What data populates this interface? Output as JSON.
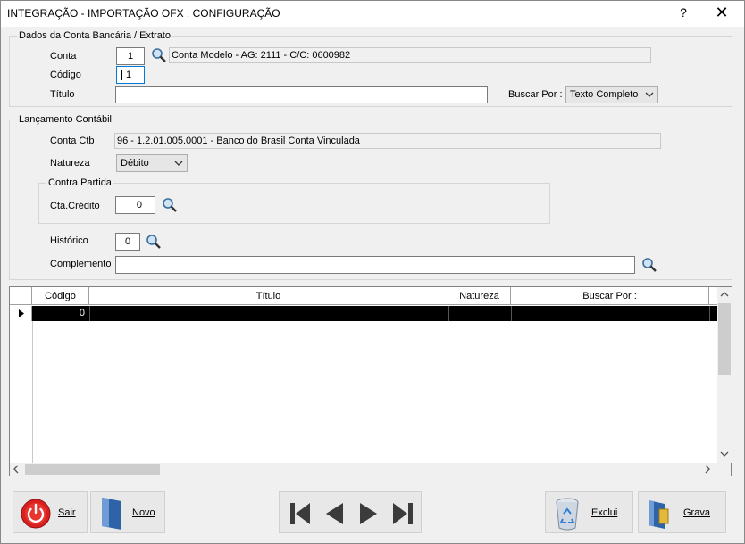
{
  "window": {
    "title": "INTEGRAÇÃO - IMPORTAÇÃO OFX : CONFIGURAÇÃO",
    "help_label": "?",
    "close_label": "✕"
  },
  "dados_conta": {
    "legend": "Dados da Conta Bancária / Extrato",
    "conta_label": "Conta",
    "conta_value": "1",
    "conta_desc": "Conta Modelo - AG: 2111   - C/C: 0600982",
    "codigo_label": "Código",
    "codigo_value": "1",
    "titulo_label": "Título",
    "titulo_value": "",
    "buscar_label": "Buscar Por :",
    "buscar_value": "Texto Completo"
  },
  "lancamento": {
    "legend": "Lançamento Contábil",
    "conta_ctb_label": "Conta Ctb",
    "conta_ctb_value": "96 - 1.2.01.005.0001 - Banco do Brasil  Conta Vinculada",
    "natureza_label": "Natureza",
    "natureza_value": "Débito",
    "contra_partida_legend": "Contra Partida",
    "cta_credito_label": "Cta.Crédito",
    "cta_credito_value": "0",
    "historico_label": "Histórico",
    "historico_value": "0",
    "complemento_label": "Complemento",
    "complemento_value": ""
  },
  "grid": {
    "columns": [
      "Código",
      "Título",
      "Natureza",
      "Buscar Por :"
    ],
    "rows": [
      {
        "codigo": "0",
        "titulo": "",
        "natureza": "",
        "buscar": ""
      }
    ]
  },
  "toolbar": {
    "sair": "Sair",
    "novo": "Novo",
    "exclui": "Exclui",
    "grava": "Grava"
  },
  "colors": {
    "selected_row": "#000000",
    "sair_red": "#d9201e"
  }
}
